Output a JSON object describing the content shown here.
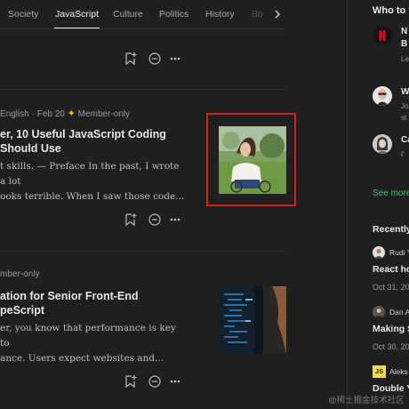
{
  "tabs": {
    "items": [
      "Society",
      "JavaScript",
      "Culture",
      "Politics",
      "History",
      "Bo"
    ],
    "active": "JavaScript"
  },
  "articles": [
    {
      "meta_lang": "English",
      "meta_dot": "·",
      "meta_date": "Feb 20",
      "meta_member": "Member-only",
      "title": "er, 10 Useful JavaScript Coding\nShould Use",
      "excerpt": "t skills. — Preface In the past, I wrote a lot\nooks terrible. When I saw those code..."
    },
    {
      "meta_member": "mber-only",
      "title": "ation for Senior Front-End\npeScript",
      "excerpt": "er, you know that performance is key to\nance. Users expect websites and..."
    }
  ],
  "sidebar": {
    "who_heading": "Who to fo",
    "who": [
      {
        "name": "N",
        "sub": "Le",
        "sub2": "B"
      },
      {
        "name": "W",
        "sub": "Jo",
        "sub2": "st"
      },
      {
        "name": "Ca",
        "sub": "I'",
        "sub2": ""
      }
    ],
    "see_more": "See more",
    "recent_heading": "Recently",
    "recent": [
      {
        "author": "Rudi Y",
        "title": "React ho",
        "date": "Oct 31, 201"
      },
      {
        "author": "Dan A",
        "title": "Making S",
        "date": "Oct 30, 201"
      },
      {
        "author": "Aleks",
        "badge": "JS",
        "title": "Double Y",
        "date": ""
      }
    ]
  },
  "watermark": "@稀土掘金技术社区",
  "colors": {
    "background": "#1f1f1f",
    "highlight_border": "#d81e1e",
    "see_more": "#3cc46a",
    "member_star": "#f4c20d",
    "netflix_red": "#e50914"
  }
}
